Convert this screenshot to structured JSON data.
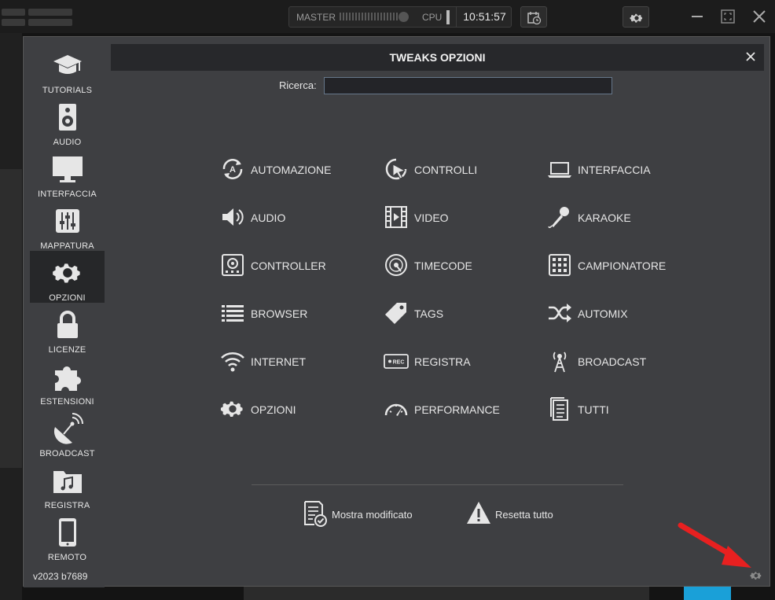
{
  "topbar": {
    "master_label": "MASTER",
    "cpu_label": "CPU",
    "clock": "10:51:57",
    "icons": [
      "menu-icon",
      "calendar-clock-icon",
      "gear-icon",
      "minimize-icon",
      "maximize-icon",
      "close-icon"
    ]
  },
  "sidebar": {
    "items": [
      {
        "label": "TUTORIALS",
        "icon": "graduation-cap-icon"
      },
      {
        "label": "AUDIO",
        "icon": "speaker-icon"
      },
      {
        "label": "INTERFACCIA",
        "icon": "monitor-icon"
      },
      {
        "label": "MAPPATURA",
        "icon": "sliders-icon"
      },
      {
        "label": "OPZIONI",
        "icon": "gear-icon",
        "active": true
      },
      {
        "label": "LICENZE",
        "icon": "lock-icon"
      },
      {
        "label": "ESTENSIONI",
        "icon": "puzzle-icon"
      },
      {
        "label": "BROADCAST",
        "icon": "satellite-dish-icon"
      },
      {
        "label": "REGISTRA",
        "icon": "music-folder-icon"
      },
      {
        "label": "REMOTO",
        "icon": "phone-icon"
      }
    ],
    "version": "v2023 b7689"
  },
  "panel": {
    "title": "TWEAKS OPZIONI",
    "search_label": "Ricerca:",
    "search_value": "",
    "categories": [
      {
        "label": "AUTOMAZIONE",
        "icon": "automation-icon"
      },
      {
        "label": "CONTROLLI",
        "icon": "cursor-click-icon"
      },
      {
        "label": "INTERFACCIA",
        "icon": "laptop-icon"
      },
      {
        "label": "AUDIO",
        "icon": "volume-icon"
      },
      {
        "label": "VIDEO",
        "icon": "film-icon"
      },
      {
        "label": "KARAOKE",
        "icon": "microphone-icon"
      },
      {
        "label": "CONTROLLER",
        "icon": "dj-controller-icon"
      },
      {
        "label": "TIMECODE",
        "icon": "vinyl-icon"
      },
      {
        "label": "CAMPIONATORE",
        "icon": "grid-pads-icon"
      },
      {
        "label": "BROWSER",
        "icon": "list-icon"
      },
      {
        "label": "TAGS",
        "icon": "tag-icon"
      },
      {
        "label": "AUTOMIX",
        "icon": "shuffle-icon"
      },
      {
        "label": "INTERNET",
        "icon": "wifi-icon"
      },
      {
        "label": "REGISTRA",
        "icon": "rec-icon"
      },
      {
        "label": "BROADCAST",
        "icon": "antenna-icon"
      },
      {
        "label": "OPZIONI",
        "icon": "gear-icon"
      },
      {
        "label": "PERFORMANCE",
        "icon": "gauge-icon"
      },
      {
        "label": "TUTTI",
        "icon": "document-icon"
      }
    ],
    "footer": {
      "show_modified": "Mostra modificato",
      "reset_all": "Resetta tutto"
    }
  },
  "colors": {
    "dialog_bg": "#3e3f42",
    "header_bg": "#27282b",
    "active_item_bg": "#262729",
    "annotation_arrow": "#e82020"
  }
}
